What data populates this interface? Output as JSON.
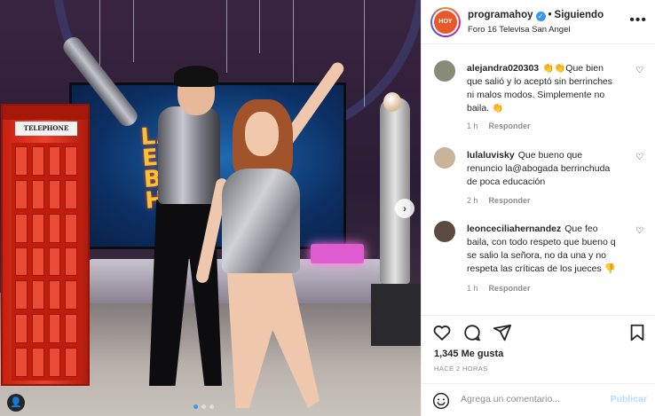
{
  "post": {
    "username": "programahoy",
    "separator": "•",
    "follow_label": "Siguiendo",
    "location": "Foro 16 Televisa San Angel",
    "avatar_text": "HOY",
    "more_glyph": "•••"
  },
  "image": {
    "booth_sign": "TELEPHONE",
    "screen_logo_lines": [
      "LA",
      "ESC",
      "BA",
      "HO"
    ],
    "carousel_count": 3,
    "carousel_active": 1
  },
  "comments": [
    {
      "username": "alejandra020303",
      "text": "👏👏Que bien que salió y lo aceptó sin berrinches ni malos modos. Simplemente no baila. 👏",
      "time": "1 h",
      "reply_label": "Responder",
      "avatar_color": "#8a8a7a"
    },
    {
      "username": "lulaluvisky",
      "text": "Que bueno que renuncio la@abogada berrinchuda de poca educación",
      "time": "2 h",
      "reply_label": "Responder",
      "avatar_color": "#c9b39a"
    },
    {
      "username": "leonceciliahernandez",
      "text": "Que feo baila, con todo respeto que bueno q se salio la señora, no da una y no respeta las críticas de los jueces 👎",
      "time": "1 h",
      "reply_label": "Responder",
      "avatar_color": "#5b4a3e"
    }
  ],
  "actions": {
    "likes": "1,345 Me gusta",
    "time_ago": "HACE 2 HORAS",
    "comment_placeholder": "Agrega un comentario...",
    "publish_label": "Publicar"
  },
  "colors": {
    "link_blue": "#3897f0",
    "publish_disabled": "#b3dbff",
    "text_primary": "#262626",
    "text_secondary": "#8e8e8e"
  }
}
